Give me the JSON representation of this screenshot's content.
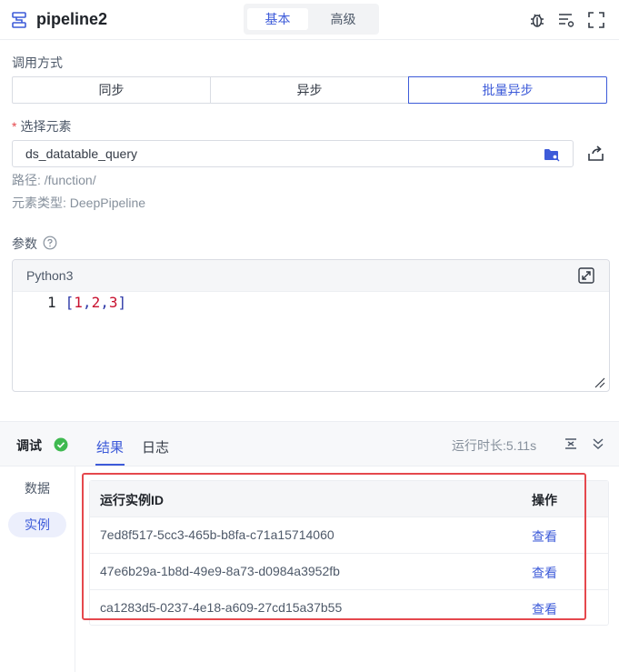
{
  "header": {
    "title": "pipeline2",
    "tabs": [
      {
        "label": "基本",
        "active": true
      },
      {
        "label": "高级",
        "active": false
      }
    ],
    "icons": [
      "bug-icon",
      "list-settings-icon",
      "fullscreen-icon"
    ]
  },
  "invocation": {
    "label": "调用方式",
    "options": [
      {
        "label": "同步",
        "selected": false
      },
      {
        "label": "异步",
        "selected": false
      },
      {
        "label": "批量异步",
        "selected": true
      }
    ]
  },
  "element": {
    "required_mark": "*",
    "label": "选择元素",
    "value": "ds_datatable_query",
    "path_label": "路径:",
    "path_value": "/function/",
    "type_label": "元素类型:",
    "type_value": "DeepPipeline"
  },
  "params": {
    "label": "参数",
    "language": "Python3",
    "code": {
      "line_number": "1",
      "open": "[",
      "v1": "1",
      "c1": ",",
      "v2": "2",
      "c2": ",",
      "v3": "3",
      "close": "]"
    }
  },
  "debug": {
    "title": "调试",
    "status": "success",
    "tabs": [
      {
        "label": "结果",
        "active": true
      },
      {
        "label": "日志",
        "active": false
      }
    ],
    "runtime": "运行时长:5.11s",
    "sidebar": [
      {
        "label": "数据",
        "active": false
      },
      {
        "label": "实例",
        "active": true
      }
    ],
    "table": {
      "columns": [
        "运行实例ID",
        "操作"
      ],
      "rows": [
        {
          "id": "7ed8f517-5cc3-465b-b8fa-c71a15714060",
          "action": "查看"
        },
        {
          "id": "47e6b29a-1b8d-49e9-8a73-d0984a3952fb",
          "action": "查看"
        },
        {
          "id": "ca1283d5-0237-4e18-a609-27cd15a37b55",
          "action": "查看"
        }
      ]
    }
  },
  "colors": {
    "accent": "#3d5bd9",
    "success": "#3fb950",
    "highlight": "#e5484d"
  }
}
